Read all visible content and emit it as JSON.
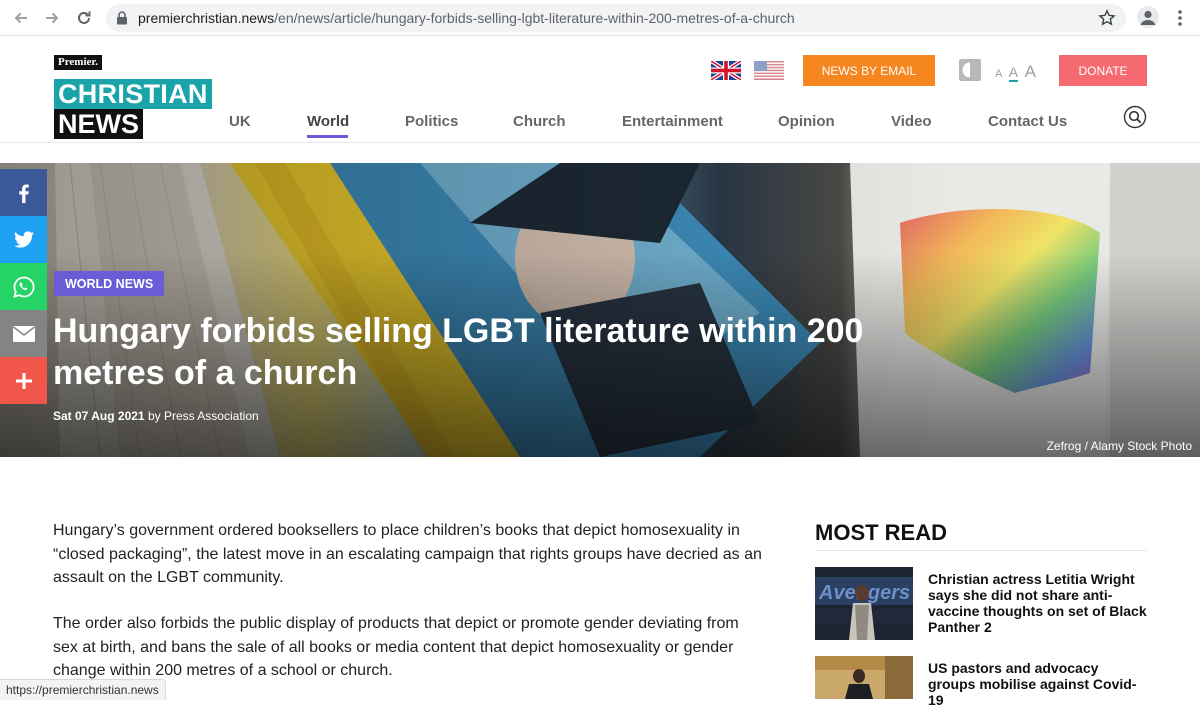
{
  "browser": {
    "url_host": "premierchristian.news",
    "url_path": "/en/news/article/hungary-forbids-selling-lgbt-literature-within-200-metres-of-a-church",
    "status_url": "https://premierchristian.news"
  },
  "site": {
    "logo_premier": "Premier.",
    "logo_christian": "CHRISTIAN",
    "logo_news": "NEWS",
    "news_by_email": "NEWS BY EMAIL",
    "donate": "DONATE",
    "font_size_letters": [
      "A",
      "A",
      "A"
    ],
    "accent_color": "#6a5bd6"
  },
  "nav": {
    "items": [
      "UK",
      "World",
      "Politics",
      "Church",
      "Entertainment",
      "Opinion",
      "Video",
      "Contact Us"
    ],
    "active": "World"
  },
  "hero": {
    "category": "WORLD NEWS",
    "headline": "Hungary forbids selling LGBT literature within 200 metres of a church",
    "date": "Sat 07 Aug 2021",
    "author": "by Press Association",
    "photo_credit": "Zefrog / Alamy Stock Photo"
  },
  "share": [
    "facebook-icon",
    "twitter-icon",
    "whatsapp-icon",
    "email-icon",
    "plus-icon"
  ],
  "article": {
    "paragraphs": [
      "Hungary’s government ordered booksellers to place children’s books that depict homosexuality in “closed packaging”, the latest move in an escalating campaign that rights groups have decried as an assault on the LGBT community.",
      "The order also forbids the public display of products that depict or promote gender deviating from sex at birth, and bans the sale of all books or media content that depict homosexuality or gender change within 200 metres of a school or church."
    ]
  },
  "most_read": {
    "title": "MOST READ",
    "items": [
      {
        "title": "Christian actress Letitia Wright says she did not share anti-vaccine thoughts on set of Black Panther 2"
      },
      {
        "title": "US pastors and advocacy groups mobilise against Covid-19"
      }
    ]
  }
}
